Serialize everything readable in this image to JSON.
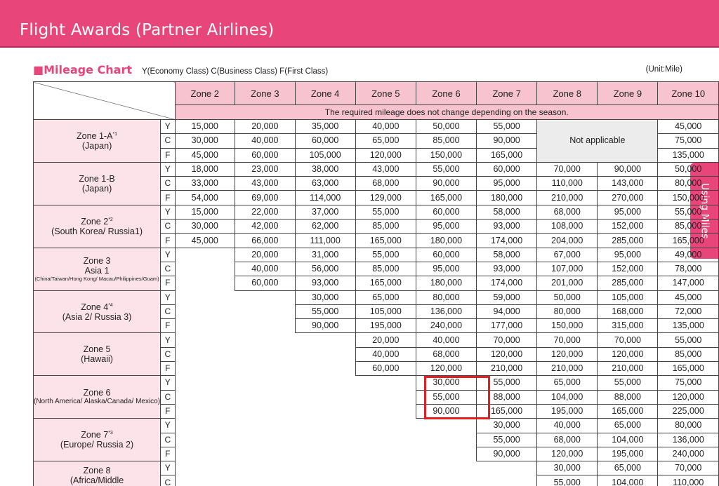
{
  "header": {
    "title": "Flight Awards (Partner Airlines)"
  },
  "side_tab": {
    "label": "Using Miles"
  },
  "section": {
    "title": "■Mileage Chart",
    "legend": "Y(Economy Class) C(Business Class) F(First Class)",
    "unit": "(Unit:Mile)"
  },
  "table": {
    "zones": [
      "Zone 2",
      "Zone 3",
      "Zone 4",
      "Zone 5",
      "Zone 6",
      "Zone 7",
      "Zone 8",
      "Zone 9",
      "Zone 10"
    ],
    "season_note": "The required mileage does not change depending on the season.",
    "not_applicable": "Not applicable",
    "classes": [
      "Y",
      "C",
      "F"
    ],
    "rows": [
      {
        "name": "Zone 1-A",
        "note": "*1",
        "sub": "(Japan)",
        "values": [
          [
            "15,000",
            "20,000",
            "35,000",
            "40,000",
            "50,000",
            "55,000",
            "",
            "",
            "45,000"
          ],
          [
            "30,000",
            "40,000",
            "60,000",
            "65,000",
            "85,000",
            "90,000",
            "",
            "",
            "75,000"
          ],
          [
            "45,000",
            "60,000",
            "105,000",
            "120,000",
            "150,000",
            "165,000",
            "",
            "",
            "135,000"
          ]
        ]
      },
      {
        "name": "Zone 1-B",
        "note": "",
        "sub": "(Japan)",
        "values": [
          [
            "18,000",
            "23,000",
            "38,000",
            "43,000",
            "55,000",
            "60,000",
            "70,000",
            "90,000",
            "50,000"
          ],
          [
            "33,000",
            "43,000",
            "63,000",
            "68,000",
            "90,000",
            "95,000",
            "110,000",
            "143,000",
            "80,000"
          ],
          [
            "54,000",
            "69,000",
            "114,000",
            "129,000",
            "165,000",
            "180,000",
            "210,000",
            "270,000",
            "150,000"
          ]
        ]
      },
      {
        "name": "Zone 2",
        "note": "*2",
        "sub": "(South Korea/ Russia1)",
        "values": [
          [
            "15,000",
            "22,000",
            "37,000",
            "55,000",
            "60,000",
            "58,000",
            "68,000",
            "95,000",
            "55,000"
          ],
          [
            "30,000",
            "42,000",
            "62,000",
            "85,000",
            "95,000",
            "93,000",
            "108,000",
            "152,000",
            "85,000"
          ],
          [
            "45,000",
            "66,000",
            "111,000",
            "165,000",
            "180,000",
            "174,000",
            "204,000",
            "285,000",
            "165,000"
          ]
        ]
      },
      {
        "name": "Zone 3",
        "note": "",
        "sub": "Asia 1",
        "tiny": "(China/Taiwan/Hong Kong/ Macau/Philippines/Guam)",
        "values": [
          [
            "",
            "20,000",
            "31,000",
            "55,000",
            "60,000",
            "58,000",
            "67,000",
            "95,000",
            "49,000"
          ],
          [
            "",
            "40,000",
            "56,000",
            "85,000",
            "95,000",
            "93,000",
            "107,000",
            "152,000",
            "78,000"
          ],
          [
            "",
            "60,000",
            "93,000",
            "165,000",
            "180,000",
            "174,000",
            "201,000",
            "285,000",
            "147,000"
          ]
        ]
      },
      {
        "name": "Zone 4",
        "note": "*4",
        "sub": "(Asia 2/ Russia 3)",
        "values": [
          [
            "",
            "",
            "30,000",
            "65,000",
            "80,000",
            "59,000",
            "50,000",
            "105,000",
            "45,000"
          ],
          [
            "",
            "",
            "55,000",
            "105,000",
            "136,000",
            "94,000",
            "80,000",
            "168,000",
            "72,000"
          ],
          [
            "",
            "",
            "90,000",
            "195,000",
            "240,000",
            "177,000",
            "150,000",
            "315,000",
            "135,000"
          ]
        ]
      },
      {
        "name": "Zone 5",
        "note": "",
        "sub": "(Hawaii)",
        "values": [
          [
            "",
            "",
            "",
            "20,000",
            "40,000",
            "70,000",
            "70,000",
            "70,000",
            "55,000"
          ],
          [
            "",
            "",
            "",
            "40,000",
            "68,000",
            "120,000",
            "120,000",
            "120,000",
            "85,000"
          ],
          [
            "",
            "",
            "",
            "60,000",
            "120,000",
            "210,000",
            "210,000",
            "210,000",
            "165,000"
          ]
        ]
      },
      {
        "name": "Zone 6",
        "note": "",
        "sub": "",
        "small": "(North America/ Alaska/Canada/ Mexico)",
        "values": [
          [
            "",
            "",
            "",
            "",
            "30,000",
            "55,000",
            "65,000",
            "55,000",
            "75,000"
          ],
          [
            "",
            "",
            "",
            "",
            "55,000",
            "88,000",
            "104,000",
            "88,000",
            "120,000"
          ],
          [
            "",
            "",
            "",
            "",
            "90,000",
            "165,000",
            "195,000",
            "165,000",
            "225,000"
          ]
        ]
      },
      {
        "name": "Zone 7",
        "note": "*3",
        "sub": "(Europe/ Russia 2)",
        "values": [
          [
            "",
            "",
            "",
            "",
            "",
            "30,000",
            "40,000",
            "65,000",
            "80,000"
          ],
          [
            "",
            "",
            "",
            "",
            "",
            "55,000",
            "68,000",
            "104,000",
            "136,000"
          ],
          [
            "",
            "",
            "",
            "",
            "",
            "90,000",
            "120,000",
            "195,000",
            "240,000"
          ]
        ]
      },
      {
        "name": "Zone 8",
        "note": "",
        "sub": "(Africa/Middle",
        "values": [
          [
            "",
            "",
            "",
            "",
            "",
            "",
            "30,000",
            "65,000",
            "70,000"
          ],
          [
            "",
            "",
            "",
            "",
            "",
            "",
            "55,000",
            "104,000",
            "110,000"
          ]
        ]
      }
    ]
  }
}
